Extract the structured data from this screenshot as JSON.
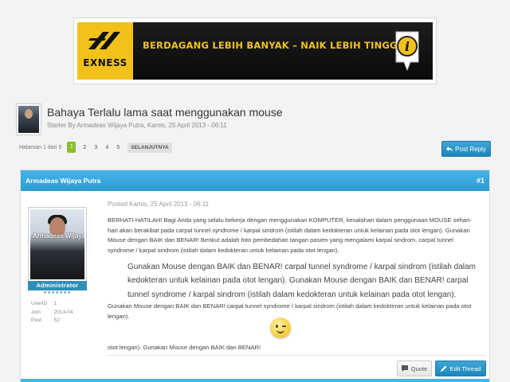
{
  "banner": {
    "brand": "EXNESS",
    "tagline": "BERDAGANG LEBIH BANYAK – NAIK LEBIH TINGGI",
    "logo_icon": "exness-logo-icon",
    "info_icon": "info-icon",
    "accent_color": "#f2c21a"
  },
  "topic": {
    "title": "Bahaya  Terlalu lama saat menggunakan mouse",
    "subtitle": "Starter By Armadeas Wijaya Putra, Kamis, 25 April 2013 - 06:11"
  },
  "pagination": {
    "label": "Halaman 1 dari 5",
    "pages": [
      "1",
      "2",
      "3",
      "4",
      "5"
    ],
    "active_page": "1",
    "next_label": "SELANJUTNYA"
  },
  "actions": {
    "post_reply": "Post Reply"
  },
  "post": {
    "author": "Armadeas Wijaya Putra",
    "number": "#1",
    "avatar_watermark": "Armadeas Wijaya",
    "role": "Administrator",
    "stars": "★★★★★★★",
    "meta": [
      {
        "key": "UserID",
        "value": ": 1"
      },
      {
        "key": "Join",
        "value": ": 2013-04"
      },
      {
        "key": "Post",
        "value": ": 52"
      }
    ],
    "date": "Posted Kamis, 25 April 2013 - 06:11",
    "para1": "BERHATI-HATILAH! Bagi Anda yang selalu bekerja dengan menggunakan KOMPUTER, kesalahan dalam penggunaan MOUSE sehari-hari akan berakibat pada carpal tunnel syndrome / karpal sindrom (istilah dalam kedokteran untuk kelainan pada otot lengan). Gunakan Mouse dengan BAIK dan BENAR! Berikut adalah foto pembedahan tangan pasien yang mengalami karpal sindrom. carpal tunnel syndrome / karpal sindrom (istilah dalam kedokteran untuk kelainan pada otot lengan).",
    "para2": "Gunakan Mouse dengan BAIK dan BENAR! carpal tunnel syndrome / karpal sindrom (istilah dalam kedokteran untuk kelainan pada otot lengan). Gunakan Mouse dengan BAIK dan BENAR! carpal tunnel syndrome / karpal sindrom (istilah dalam kedokteran untuk kelainan pada otot lengan).",
    "para3": "Gunakan Mouse dengan BAIK dan BENAR! carpal tunnel syndrome / karpal sindrom (istilah dalam kedokteran untuk kelainan pada otot lengan).",
    "para4": "otot lengan). Gunakan Mouse dengan BAIK dan BENAR!",
    "quote_label": "Quote",
    "edit_label": "Edit Thread"
  }
}
